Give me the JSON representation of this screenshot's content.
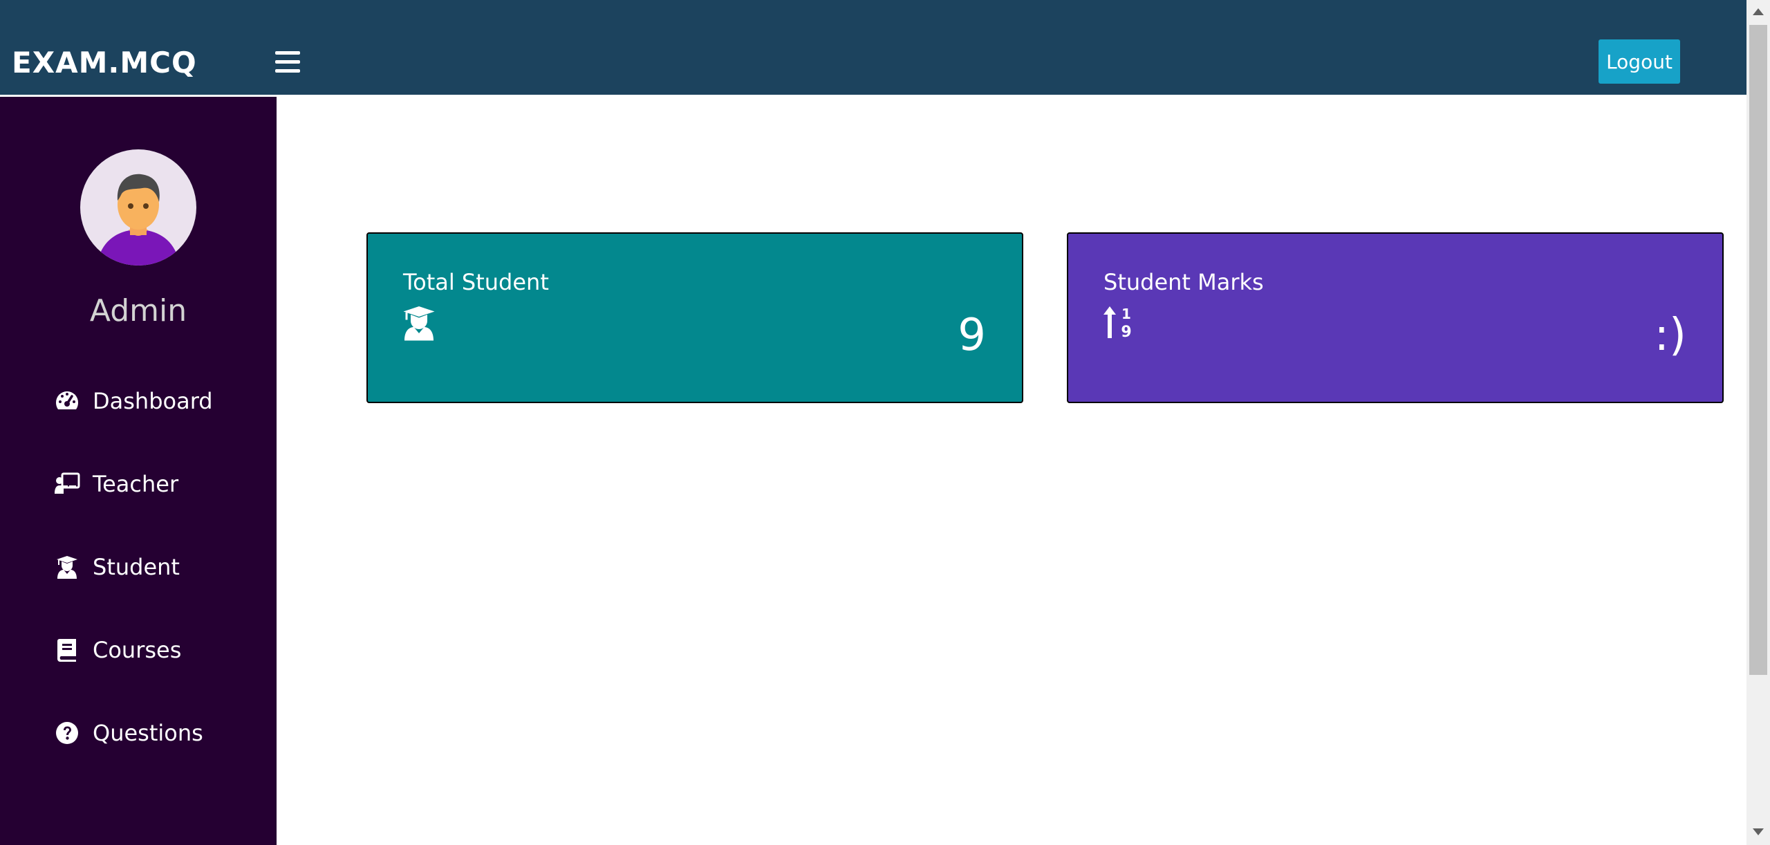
{
  "navbar": {
    "brand": "EXAM.MCQ",
    "menu_icon": "hamburger-menu-icon",
    "logout_label": "Logout",
    "background": "#1c435e",
    "logout_color": "#17a2c8"
  },
  "sidebar": {
    "avatar_icon": "user-avatar-icon",
    "title": "Admin",
    "background": "#250032",
    "items": [
      {
        "label": "Dashboard",
        "icon": "tachometer-icon"
      },
      {
        "label": "Teacher",
        "icon": "chalkboard-teacher-icon"
      },
      {
        "label": "Student",
        "icon": "user-graduate-icon"
      },
      {
        "label": "Courses",
        "icon": "book-icon"
      },
      {
        "label": "Questions",
        "icon": "question-circle-icon"
      }
    ]
  },
  "cards": [
    {
      "label": "Total Student",
      "icon": "user-graduate-icon",
      "value": "9",
      "color": "#03888e"
    },
    {
      "label": "Student Marks",
      "icon": "sort-numeric-up-icon",
      "value": ":)",
      "color": "#5a38b6"
    }
  ]
}
